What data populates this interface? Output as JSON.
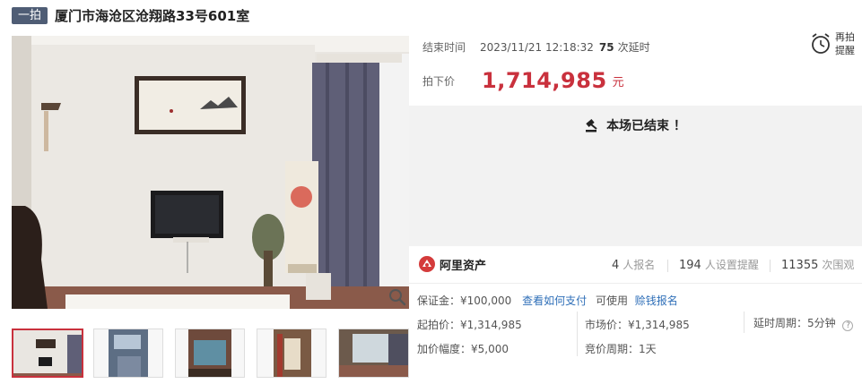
{
  "header": {
    "tag": "一拍",
    "title": "厦门市海沧区沧翔路33号601室"
  },
  "gallery": {
    "zoom_icon": "zoom-icon",
    "thumbnail_count": 5
  },
  "auction": {
    "end_time_label": "结束时间",
    "end_time": "2023/11/21 12:18:32",
    "delay_count": "75",
    "delay_text": "次延时",
    "remind_label": "再拍提醒",
    "price_label": "拍下价",
    "price": "1,714,985",
    "price_unit": "元",
    "ended_text": "本场已结束 ！"
  },
  "stats": {
    "brand": "阿里资产",
    "signups": "4",
    "signups_label": "人报名",
    "reminders": "194",
    "reminders_label": "人设置提醒",
    "views": "11355",
    "views_label": "次围观"
  },
  "details": {
    "deposit": "保证金：¥100,000",
    "how_to_pay": "查看如何支付",
    "usable": "可使用",
    "credit_signup": "赊钱报名",
    "start_price": "起拍价：¥1,314,985",
    "market_price": "市场价：¥1,314,985",
    "delay_cycle": "延时周期：5分钟",
    "increment": "加价幅度：¥5,000",
    "bid_cycle": "竞价周期：1天"
  },
  "colors": {
    "accent": "#c9313d",
    "tag_bg": "#4f5d75",
    "link": "#2f6fb8"
  }
}
